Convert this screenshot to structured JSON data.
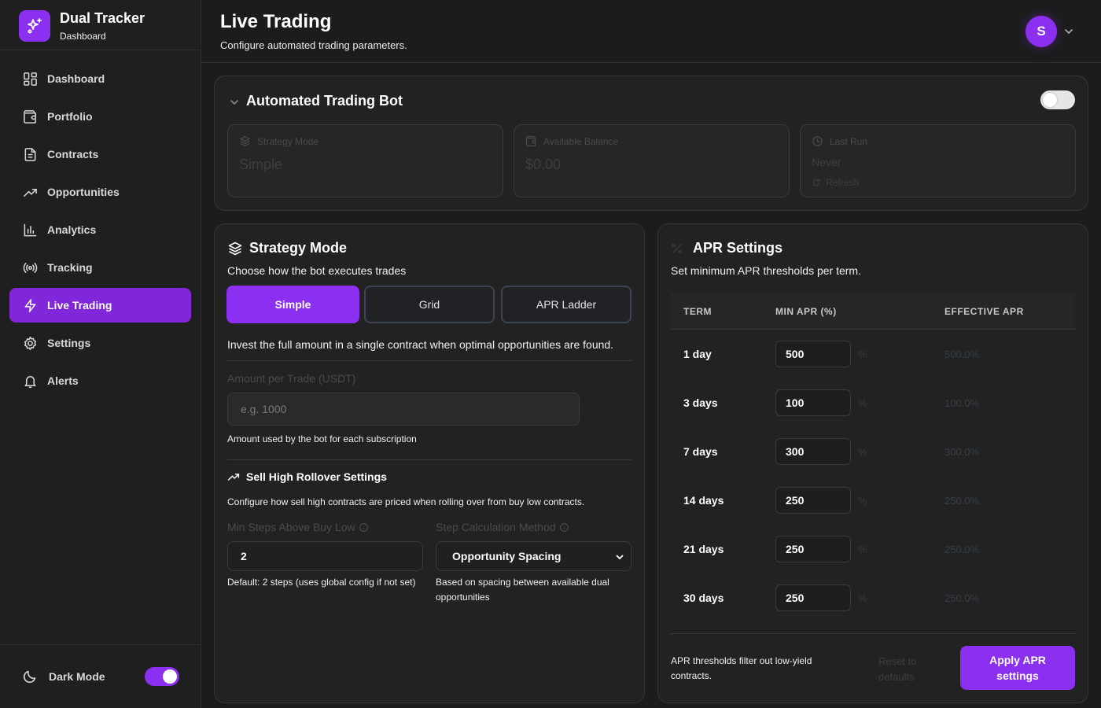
{
  "brand": {
    "title": "Dual Tracker",
    "subtitle": "Dashboard"
  },
  "sidebar": {
    "items": [
      {
        "label": "Dashboard",
        "icon": "layout-grid-icon"
      },
      {
        "label": "Portfolio",
        "icon": "wallet-icon"
      },
      {
        "label": "Contracts",
        "icon": "document-icon"
      },
      {
        "label": "Opportunities",
        "icon": "trending-up-icon"
      },
      {
        "label": "Analytics",
        "icon": "bar-chart-icon"
      },
      {
        "label": "Tracking",
        "icon": "broadcast-icon"
      },
      {
        "label": "Live Trading",
        "icon": "lightning-icon",
        "active": true
      },
      {
        "label": "Settings",
        "icon": "gear-icon"
      },
      {
        "label": "Alerts",
        "icon": "bell-icon"
      }
    ],
    "dark_mode_label": "Dark Mode",
    "dark_mode_on": true
  },
  "header": {
    "title": "Live Trading",
    "subtitle": "Configure automated trading parameters.",
    "avatar_initial": "S"
  },
  "bot": {
    "title": "Automated Trading Bot",
    "enabled": false,
    "stats": {
      "strategy_label": "Strategy Mode",
      "strategy_value": "Simple",
      "balance_label": "Available Balance",
      "balance_value": "$0.00",
      "last_run_label": "Last Run",
      "last_run_value": "Never",
      "refresh_label": "Refresh"
    }
  },
  "strategy": {
    "title": "Strategy Mode",
    "subtitle": "Choose how the bot executes trades",
    "modes": [
      "Simple",
      "Grid",
      "APR Ladder"
    ],
    "selected_mode": "Simple",
    "description": "Invest the full amount in a single contract when optimal opportunities are found.",
    "amount_label": "Amount per Trade (USDT)",
    "amount_placeholder": "e.g. 1000",
    "amount_helper": "Amount used by the bot for each subscription",
    "rollover_title": "Sell High Rollover Settings",
    "rollover_desc": "Configure how sell high contracts are priced when rolling over from buy low contracts.",
    "min_steps_label": "Min Steps Above Buy Low",
    "min_steps_value": "2",
    "min_steps_helper": "Default: 2 steps (uses global config if not set)",
    "method_label": "Step Calculation Method",
    "method_value": "Opportunity Spacing",
    "method_helper": "Based on spacing between available dual opportunities"
  },
  "apr": {
    "title": "APR Settings",
    "subtitle": "Set minimum APR thresholds per term.",
    "columns": [
      "TERM",
      "MIN APR (%)",
      "EFFECTIVE APR"
    ],
    "rows": [
      {
        "term": "1 day",
        "min_apr": "500",
        "unit": "%",
        "effective": "500.0%"
      },
      {
        "term": "3 days",
        "min_apr": "100",
        "unit": "%",
        "effective": "100.0%"
      },
      {
        "term": "7 days",
        "min_apr": "300",
        "unit": "%",
        "effective": "300.0%"
      },
      {
        "term": "14 days",
        "min_apr": "250",
        "unit": "%",
        "effective": "250.0%"
      },
      {
        "term": "21 days",
        "min_apr": "250",
        "unit": "%",
        "effective": "250.0%"
      },
      {
        "term": "30 days",
        "min_apr": "250",
        "unit": "%",
        "effective": "250.0%"
      }
    ],
    "note": "APR thresholds filter out low-yield contracts.",
    "reset_label": "Reset to defaults",
    "apply_label": "Apply APR settings"
  },
  "colors": {
    "accent": "#8b2ff0",
    "background": "#1c1c1c",
    "card": "#222222"
  }
}
